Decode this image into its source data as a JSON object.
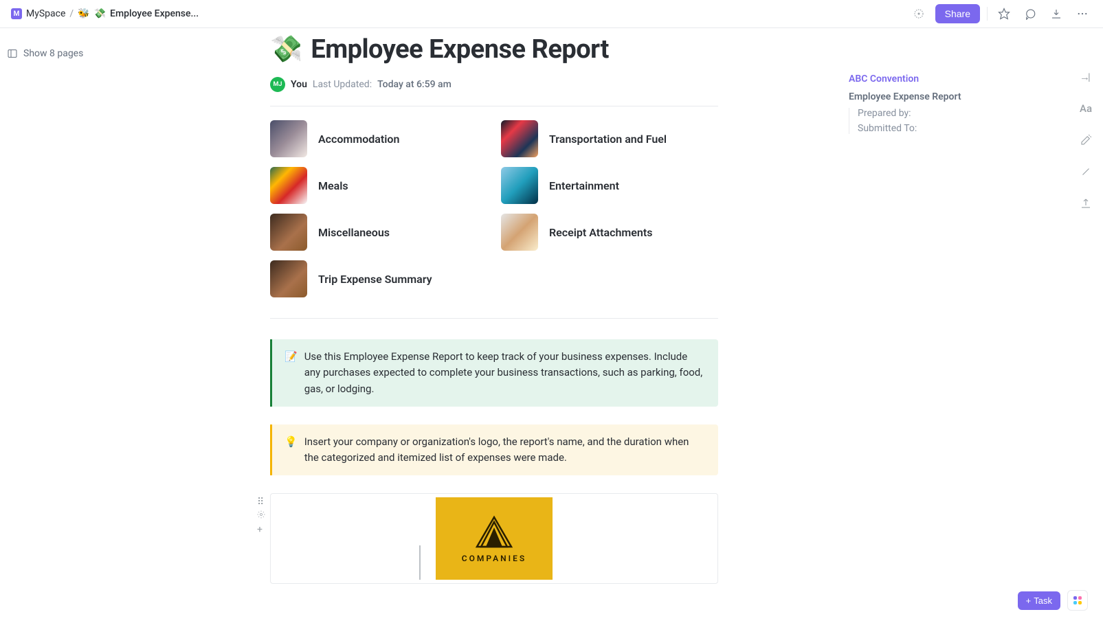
{
  "breadcrumb": {
    "workspace_badge": "M",
    "workspace": "MySpace",
    "separator": "/",
    "emoji1": "🐝",
    "emoji2": "💸",
    "title": "Employee Expense..."
  },
  "topbar": {
    "share_label": "Share"
  },
  "left_panel": {
    "show_pages": "Show 8 pages"
  },
  "page": {
    "emoji": "💸",
    "title": "Employee Expense Report"
  },
  "meta": {
    "avatar_initials": "MJ",
    "you": "You",
    "updated_label": "Last Updated:",
    "updated_time": "Today at 6:59 am"
  },
  "cards": [
    {
      "title": "Accommodation",
      "thumb": "thumb-accommodation"
    },
    {
      "title": "Transportation and Fuel",
      "thumb": "thumb-transport"
    },
    {
      "title": "Meals",
      "thumb": "thumb-meals"
    },
    {
      "title": "Entertainment",
      "thumb": "thumb-entertainment"
    },
    {
      "title": "Miscellaneous",
      "thumb": "thumb-misc"
    },
    {
      "title": "Receipt Attachments",
      "thumb": "thumb-receipt"
    },
    {
      "title": "Trip Expense Summary",
      "thumb": "thumb-summary"
    }
  ],
  "callouts": {
    "green_emoji": "📝",
    "green_text": "Use this Employee Expense Report to keep track of your business expenses. Include any purchases expected to complete your business transactions, such as parking, food, gas, or lodging.",
    "yellow_emoji": "💡",
    "yellow_text": "Insert your company or organization's logo, the report's name, and the duration when the categorized and itemized list of expenses were made."
  },
  "logo": {
    "text": "COMPANIES"
  },
  "outline": {
    "h1": "ABC Convention",
    "h2": "Employee Expense Report",
    "items": [
      "Prepared by:",
      "Submitted To:"
    ]
  },
  "right_rail": {
    "font_label": "Aa"
  },
  "bottom": {
    "task_label": "Task"
  }
}
